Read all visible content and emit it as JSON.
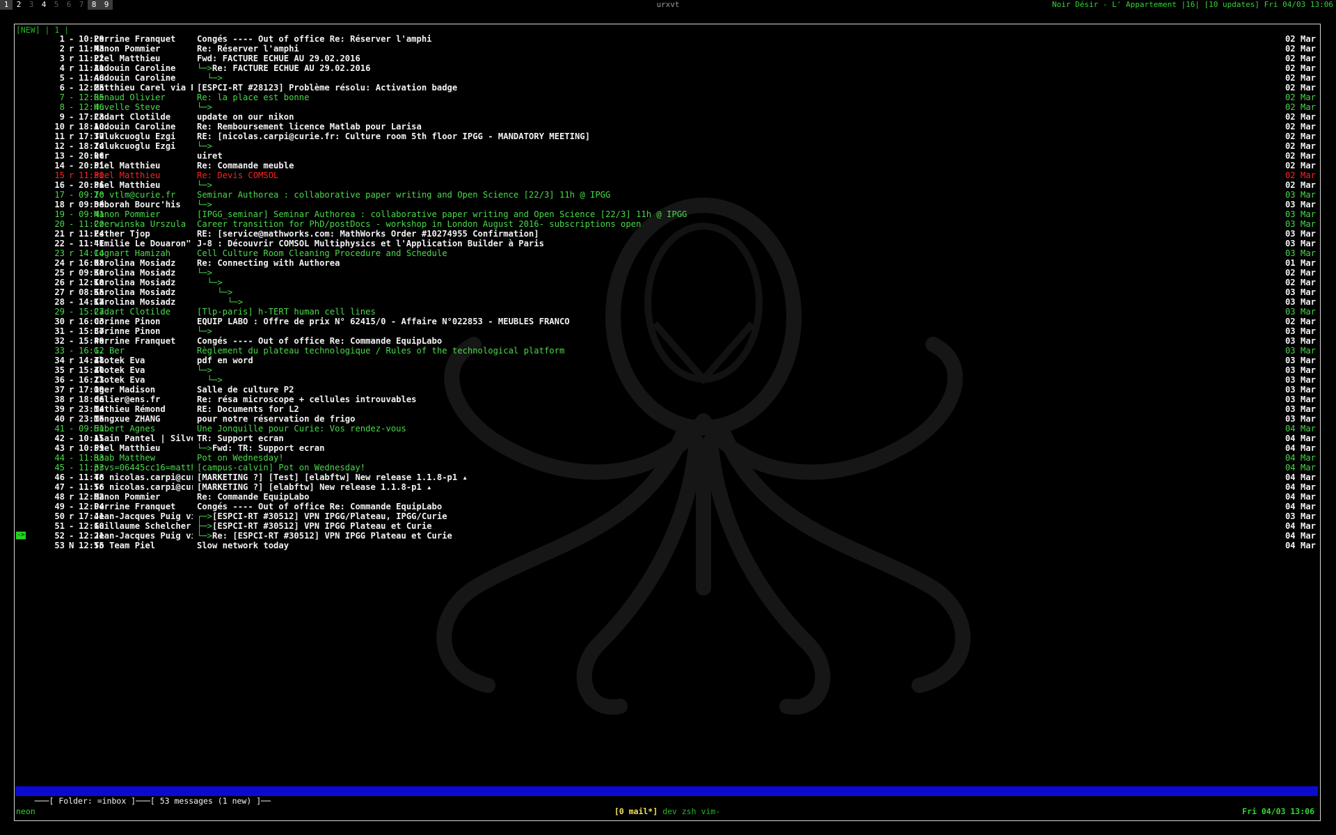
{
  "topbar": {
    "workspaces": [
      "1",
      "2",
      "3",
      "4",
      "5",
      "6",
      "7",
      "8",
      "9"
    ],
    "window_title": "urxvt",
    "status": "Noir Désir - L' Appartement |16| [10 updates] Fri 04/03 13:06"
  },
  "mutt": {
    "tabline": "[NEW] | 1 |",
    "cursor_glyph": "->",
    "messages": [
      {
        "num": "1",
        "flag": "-",
        "time": "10:29",
        "from": "Perrine Franquet",
        "tree": "",
        "subject": "Congés ---- Out of office Re: Réserver l'amphi",
        "date": "02 Mar"
      },
      {
        "num": "2",
        "flag": "r",
        "time": "11:43",
        "from": "Manon Pommier",
        "tree": "",
        "subject": "Re: Réserver l'amphi",
        "date": "02 Mar"
      },
      {
        "num": "3",
        "flag": "r",
        "time": "11:22",
        "from": "Piel Matthieu",
        "tree": "",
        "subject": "Fwd: FACTURE ECHUE AU 29.02.2016",
        "date": "02 Mar"
      },
      {
        "num": "4",
        "flag": "r",
        "time": "11:31",
        "from": "Audouin Caroline",
        "tree": "└─>",
        "subject": "Re: FACTURE ECHUE AU 29.02.2016",
        "date": "02 Mar"
      },
      {
        "num": "5",
        "flag": "-",
        "time": "11:46",
        "from": "Audouin Caroline",
        "tree": "  └─>",
        "subject": "",
        "date": "02 Mar"
      },
      {
        "num": "6",
        "flag": "-",
        "time": "12:25",
        "from": "Matthieu Carel via R",
        "tree": "",
        "subject": "[ESPCI-RT #28123] Problème résolu: Activation badge",
        "date": "02 Mar"
      },
      {
        "num": "7",
        "flag": "-",
        "time": "12:05",
        "from": "Renaud Olivier",
        "tree": "",
        "subject": "Re: la place est bonne",
        "date": "02 Mar"
      },
      {
        "num": "8",
        "flag": "-",
        "time": "12:46",
        "from": "Huvelle Steve",
        "tree": "└─>",
        "subject": "",
        "date": "02 Mar"
      },
      {
        "num": "9",
        "flag": "-",
        "time": "17:23",
        "from": "Cadart Clotilde",
        "tree": "",
        "subject": "update on our nikon",
        "date": "02 Mar"
      },
      {
        "num": "10",
        "flag": "r",
        "time": "18:10",
        "from": "Audouin Caroline",
        "tree": "",
        "subject": "Re: Remboursement licence Matlab pour Larisa",
        "date": "02 Mar"
      },
      {
        "num": "11",
        "flag": "r",
        "time": "17:37",
        "from": "Tulukcuoglu Ezgi",
        "tree": "",
        "subject": "RE: [nicolas.carpi@curie.fr: Culture room 5th floor IPGG - MANDATORY MEETING]",
        "date": "02 Mar"
      },
      {
        "num": "12",
        "flag": "-",
        "time": "18:24",
        "from": "Tulukcuoglu Ezgi",
        "tree": "└─>",
        "subject": "",
        "date": "02 Mar"
      },
      {
        "num": "13",
        "flag": "-",
        "time": "20:06",
        "from": "ktr",
        "tree": "",
        "subject": "uiret",
        "date": "02 Mar"
      },
      {
        "num": "14",
        "flag": "-",
        "time": "20:31",
        "from": "Piel Matthieu",
        "tree": "",
        "subject": "Re: Commande meuble",
        "date": "02 Mar"
      },
      {
        "num": "15",
        "flag": "r",
        "time": "11:30",
        "from": "Piel Matthieu",
        "tree": "",
        "subject": "Re: Devis COMSOL",
        "date": "02 Mar"
      },
      {
        "num": "16",
        "flag": "-",
        "time": "20:36",
        "from": "Piel Matthieu",
        "tree": "└─>",
        "subject": "",
        "date": "02 Mar"
      },
      {
        "num": "17",
        "flag": "-",
        "time": "09:20",
        "from": "To vtlm@curie.fr",
        "tree": "",
        "subject": "Seminar Authorea : collaborative paper writing and Open Science [22/3] 11h @ IPGG",
        "date": "03 Mar"
      },
      {
        "num": "18",
        "flag": "r",
        "time": "09:38",
        "from": "Déborah Bourc'his",
        "tree": "└─>",
        "subject": "",
        "date": "03 Mar"
      },
      {
        "num": "19",
        "flag": "-",
        "time": "09:41",
        "from": "Manon Pommier",
        "tree": "",
        "subject": "[IPGG_seminar] Seminar Authorea : collaborative paper writing and Open Science [22/3] 11h @ IPGG",
        "date": "03 Mar"
      },
      {
        "num": "20",
        "flag": "-",
        "time": "11:20",
        "from": "Czerwinska Urszula",
        "tree": "",
        "subject": "Career transition for PhD/postDocs - workshop in London August 2016- subscriptions open",
        "date": "03 Mar"
      },
      {
        "num": "21",
        "flag": "r",
        "time": "11:24",
        "from": "Esther Tjop",
        "tree": "",
        "subject": "RE: [service@mathworks.com: MathWorks Order #10274955 Confirmation]",
        "date": "03 Mar"
      },
      {
        "num": "22",
        "flag": "-",
        "time": "11:41",
        "from": "\"Emilie Le Douaron\"",
        "tree": "",
        "subject": "J-8 : Découvrir COMSOL Multiphysics et l'Application Builder à Paris",
        "date": "03 Mar"
      },
      {
        "num": "23",
        "flag": "r",
        "time": "14:14",
        "from": "Cognart Hamizah",
        "tree": "",
        "subject": "Cell Culture Room Cleaning Procedure and Schedule",
        "date": "03 Mar"
      },
      {
        "num": "24",
        "flag": "r",
        "time": "16:08",
        "from": "Karolina Mosiadz",
        "tree": "",
        "subject": "Re: Connecting with Authorea",
        "date": "01 Mar"
      },
      {
        "num": "25",
        "flag": "r",
        "time": "09:30",
        "from": "Karolina Mosiadz",
        "tree": "└─>",
        "subject": "",
        "date": "02 Mar"
      },
      {
        "num": "26",
        "flag": "r",
        "time": "12:10",
        "from": "Karolina Mosiadz",
        "tree": "  └─>",
        "subject": "",
        "date": "02 Mar"
      },
      {
        "num": "27",
        "flag": "r",
        "time": "08:55",
        "from": "Karolina Mosiadz",
        "tree": "    └─>",
        "subject": "",
        "date": "03 Mar"
      },
      {
        "num": "28",
        "flag": "-",
        "time": "14:17",
        "from": "Karolina Mosiadz",
        "tree": "      └─>",
        "subject": "",
        "date": "03 Mar"
      },
      {
        "num": "29",
        "flag": "-",
        "time": "15:27",
        "from": "Cadart Clotilde",
        "tree": "",
        "subject": "[Tlp-paris] h-TERT human cell lines",
        "date": "03 Mar"
      },
      {
        "num": "30",
        "flag": "r",
        "time": "16:03",
        "from": "Corinne Pinon",
        "tree": "",
        "subject": "EQUIP LABO : Offre de prix N° 62415/0 - Affaire N°022853 - MEUBLES FRANCO",
        "date": "02 Mar"
      },
      {
        "num": "31",
        "flag": "-",
        "time": "15:37",
        "from": "Corinne Pinon",
        "tree": "└─>",
        "subject": "",
        "date": "03 Mar"
      },
      {
        "num": "32",
        "flag": "-",
        "time": "15:49",
        "from": "Perrine Franquet",
        "tree": "",
        "subject": "Congés ---- Out of office Re: Commande EquipLabo",
        "date": "03 Mar"
      },
      {
        "num": "33",
        "flag": "-",
        "time": "16:12",
        "from": "G. Ber",
        "tree": "",
        "subject": "Règlement du plateau technologique / Rules of the technological platform",
        "date": "03 Mar"
      },
      {
        "num": "34",
        "flag": "r",
        "time": "14:48",
        "from": "Zlotek Eva",
        "tree": "",
        "subject": "pdf en word",
        "date": "03 Mar"
      },
      {
        "num": "35",
        "flag": "r",
        "time": "15:40",
        "from": "Zlotek Eva",
        "tree": "└─>",
        "subject": "",
        "date": "03 Mar"
      },
      {
        "num": "36",
        "flag": "-",
        "time": "16:13",
        "from": "Zlotek Eva",
        "tree": "  └─>",
        "subject": "",
        "date": "03 Mar"
      },
      {
        "num": "37",
        "flag": "r",
        "time": "17:19",
        "from": "Oger Madison",
        "tree": "",
        "subject": "Salle de culture P2",
        "date": "03 Mar"
      },
      {
        "num": "38",
        "flag": "r",
        "time": "18:06",
        "from": "dalier@ens.fr",
        "tree": "",
        "subject": "Re: résa microscope + cellules introuvables",
        "date": "03 Mar"
      },
      {
        "num": "39",
        "flag": "r",
        "time": "23:14",
        "from": "Mathieu Rémond",
        "tree": "",
        "subject": "RE: Documents for L2",
        "date": "03 Mar"
      },
      {
        "num": "40",
        "flag": "r",
        "time": "23:15",
        "from": "Mengxue ZHANG",
        "tree": "",
        "subject": "pour notre réservation de frigo",
        "date": "03 Mar"
      },
      {
        "num": "41",
        "flag": "-",
        "time": "09:51",
        "from": "Hubert Agnes",
        "tree": "",
        "subject": "Une Jonquille pour Curie: Vos rendez-vous",
        "date": "04 Mar"
      },
      {
        "num": "42",
        "flag": "-",
        "time": "10:15",
        "from": "Alain Pantel | Silve",
        "tree": "",
        "subject": "TR: Support ecran",
        "date": "04 Mar"
      },
      {
        "num": "43",
        "flag": "r",
        "time": "10:59",
        "from": "Piel Matthieu",
        "tree": "└─>",
        "subject": "Fwd: TR: Support ecran",
        "date": "04 Mar"
      },
      {
        "num": "44",
        "flag": "-",
        "time": "11:33",
        "from": "Raab Matthew",
        "tree": "",
        "subject": "Pot on Wednesday!",
        "date": "04 Mar"
      },
      {
        "num": "45",
        "flag": "-",
        "time": "11:33",
        "from": "prvs=06445cc16=matth",
        "tree": "",
        "subject": "[campus-calvin] Pot on Wednesday!",
        "date": "04 Mar"
      },
      {
        "num": "46",
        "flag": "-",
        "time": "11:48",
        "from": "To nicolas.carpi@cur",
        "tree": "",
        "subject": "[MARKETING ?] [Test] [elabftw] New release 1.1.8-p1 ▴",
        "date": "04 Mar"
      },
      {
        "num": "47",
        "flag": "-",
        "time": "11:56",
        "from": "To nicolas.carpi@cur",
        "tree": "",
        "subject": "[MARKETING ?] [elabftw] New release 1.1.8-p1 ▴",
        "date": "04 Mar"
      },
      {
        "num": "48",
        "flag": "r",
        "time": "12:02",
        "from": "Manon Pommier",
        "tree": "",
        "subject": "Re: Commande EquipLabo",
        "date": "04 Mar"
      },
      {
        "num": "49",
        "flag": "-",
        "time": "12:04",
        "from": "Perrine Franquet",
        "tree": "",
        "subject": "Congés ---- Out of office Re: Commande EquipLabo",
        "date": "04 Mar"
      },
      {
        "num": "50",
        "flag": "r",
        "time": "17:41",
        "from": "Jean-Jacques Puig vi",
        "tree": "┌─>",
        "subject": "[ESPCI-RT #30512] VPN IPGG/Plateau, IPGG/Curie",
        "date": "03 Mar"
      },
      {
        "num": "51",
        "flag": "-",
        "time": "12:18",
        "from": "Guillaume Schelcher",
        "tree": "├─>",
        "subject": "[ESPCI-RT #30512] VPN IPGG Plateau et Curie",
        "date": "04 Mar"
      },
      {
        "num": "52",
        "flag": "-",
        "time": "12:21",
        "from": "Jean-Jacques Puig vi",
        "tree": "└─>",
        "subject": "Re: [ESPCI-RT #30512] VPN IPGG Plateau et Curie",
        "date": "04 Mar"
      },
      {
        "num": "53",
        "flag": "N",
        "time": "12:55",
        "from": "To Team Piel",
        "tree": "",
        "subject": "Slow network today",
        "date": "04 Mar"
      }
    ],
    "status_line": "───[ Folder: =inbox ]───[ 53 messages (1 new) ]──"
  },
  "bottom": {
    "hostname": "neon",
    "mail_indicator": "[0 mail*]",
    "tmux_windows": " dev zsh vim-",
    "clock": "Fri 04/03 13:06"
  },
  "colors": {
    "normal": "#f2f2f2",
    "green": "#4ad94a",
    "red": "#ff2020",
    "status_bg": "#0a0ad0"
  },
  "row_styles": {
    "green": [
      "7",
      "8",
      "17",
      "19",
      "20",
      "23",
      "29",
      "33",
      "41",
      "44",
      "45"
    ],
    "red": [
      "15"
    ]
  },
  "cursor_row": "52"
}
